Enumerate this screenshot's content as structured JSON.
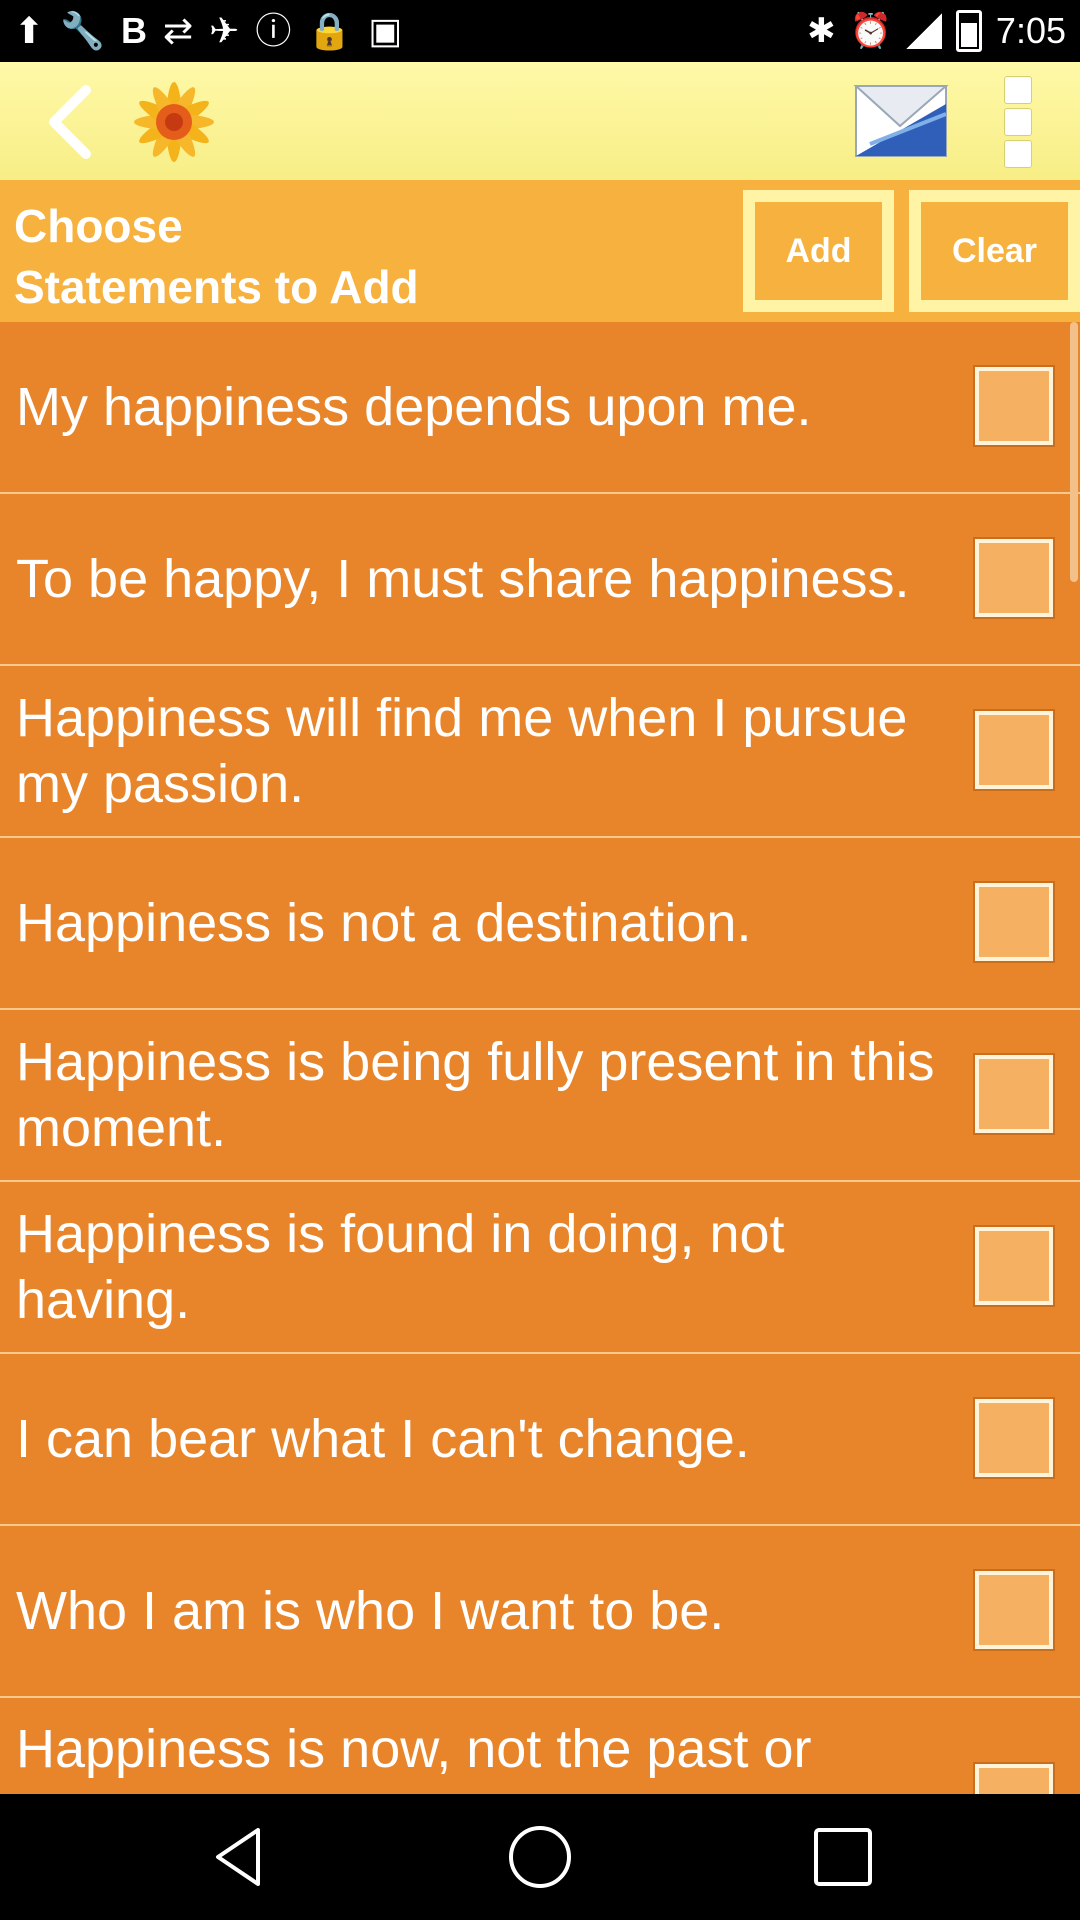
{
  "status_bar": {
    "time": "7:05",
    "left_icons": [
      "wrench-icon",
      "bold-icon",
      "swap-icon",
      "fake-gps-icon",
      "info-icon",
      "lock-icon",
      "android-icon"
    ],
    "right_icons": [
      "bluetooth-icon",
      "alarm-icon",
      "signal-icon",
      "battery-icon"
    ]
  },
  "app_bar": {
    "back_icon": "chevron-left-icon",
    "logo_icon": "flower-icon",
    "mail_icon": "envelope-icon",
    "overflow_icon": "overflow-menu-icon"
  },
  "header": {
    "title": "Choose\nStatements to Add",
    "add_label": "Add",
    "clear_label": "Clear"
  },
  "statements": [
    {
      "text": "My happiness depends upon me.",
      "checked": false
    },
    {
      "text": "To be happy, I must share happiness.",
      "checked": false
    },
    {
      "text": "Happiness will find me when I pursue my passion.",
      "checked": false
    },
    {
      "text": "Happiness is not a destination.",
      "checked": false
    },
    {
      "text": "Happiness is being fully present in this moment.",
      "checked": false
    },
    {
      "text": "Happiness is found in doing, not having.",
      "checked": false
    },
    {
      "text": "I can bear what I can't change.",
      "checked": false
    },
    {
      "text": "Who I am is who I want to be.",
      "checked": false
    },
    {
      "text": "Happiness is now, not the past or",
      "checked": false
    }
  ],
  "colors": {
    "app_bar": "#f7ee86",
    "header": "#f6b13e",
    "list_bg": "#e8852a",
    "checkbox": "#f6b061"
  }
}
